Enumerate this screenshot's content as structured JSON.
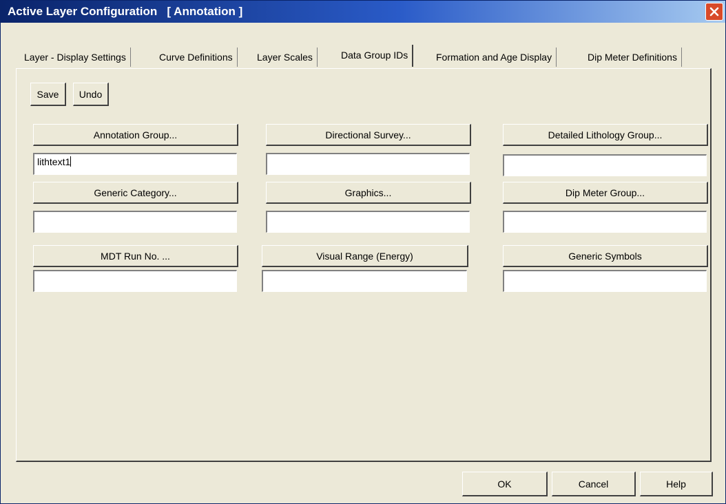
{
  "window": {
    "title": "Active Layer Configuration   [ Annotation ]",
    "close_icon": "close-icon"
  },
  "tabs": [
    {
      "label": "Layer - Display Settings"
    },
    {
      "label": "Curve Definitions"
    },
    {
      "label": "Layer Scales"
    },
    {
      "label": "Data Group IDs",
      "active": true
    },
    {
      "label": "Formation and Age Display"
    },
    {
      "label": "Dip Meter Definitions"
    }
  ],
  "toolbar": {
    "save_label": "Save",
    "undo_label": "Undo"
  },
  "groups": {
    "annotation": {
      "label": "Annotation Group...",
      "value": "lithtext1"
    },
    "directional_survey": {
      "label": "Directional Survey...",
      "value": ""
    },
    "detailed_lithology": {
      "label": "Detailed Lithology Group...",
      "value": ""
    },
    "generic_category": {
      "label": "Generic Category...",
      "value": ""
    },
    "graphics": {
      "label": "Graphics...",
      "value": ""
    },
    "dip_meter": {
      "label": "Dip Meter Group...",
      "value": ""
    },
    "mdt_run": {
      "label": "MDT Run No. ...",
      "value": ""
    },
    "visual_range": {
      "label": "Visual Range (Energy)",
      "value": ""
    },
    "generic_symbols": {
      "label": "Generic Symbols",
      "value": ""
    }
  },
  "footer": {
    "ok_label": "OK",
    "cancel_label": "Cancel",
    "help_label": "Help"
  },
  "colors": {
    "titlebar": "#0a246a",
    "face": "#ece9d8",
    "close": "#d84a2a"
  }
}
